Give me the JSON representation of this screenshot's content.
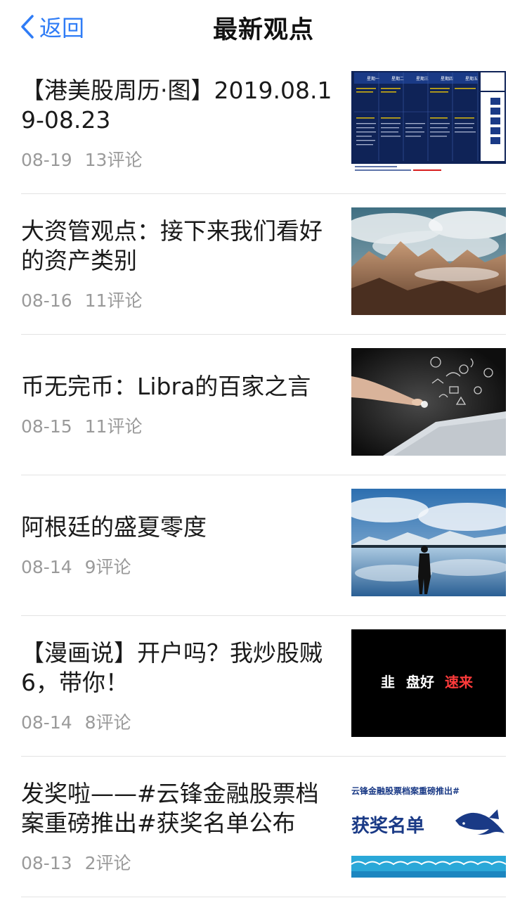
{
  "nav": {
    "back_label": "返回",
    "title": "最新观点"
  },
  "articles": [
    {
      "title": "【港美股周历·图】2019.08.19-08.23",
      "date": "08-19",
      "comments": "13评论"
    },
    {
      "title": "大资管观点：接下来我们看好的资产类别",
      "date": "08-16",
      "comments": "11评论"
    },
    {
      "title": "币无完币：Libra的百家之言",
      "date": "08-15",
      "comments": "11评论"
    },
    {
      "title": "阿根廷的盛夏零度",
      "date": "08-14",
      "comments": "9评论"
    },
    {
      "title": "【漫画说】开户吗？我炒股贼6，带你！",
      "date": "08-14",
      "comments": "8评论"
    },
    {
      "title": "发奖啦——#云锋金融股票档案重磅推出#获奖名单公布",
      "date": "08-13",
      "comments": "2评论"
    }
  ],
  "thumbs": {
    "cal_headers": [
      "星期一",
      "星期二",
      "星期三",
      "星期四",
      "星期五"
    ],
    "comic_words": [
      "韭",
      "盘好",
      "速来"
    ],
    "award_banner": "云锋金融股票档案重磅推出#",
    "award_title": "获奖名单"
  },
  "colors": {
    "accent": "#2f7cf6",
    "meta_text": "#9a9a9a",
    "divider": "#e3e3e3"
  }
}
